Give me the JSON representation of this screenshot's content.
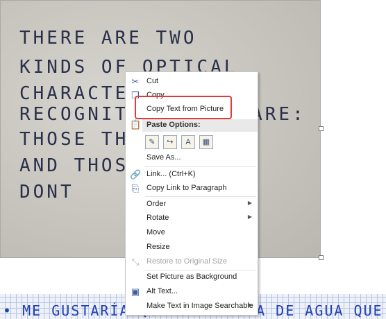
{
  "picture": {
    "lines": [
      "THERE ARE TWO",
      "KINDS OF OPTICAL",
      "CHARACTER",
      "RECOGNITION SOFTWARE:",
      "THOSE THAT",
      "AND THOSE",
      "DONT"
    ]
  },
  "bottom_strip": {
    "text": "• ME GUSTARÍA QUE CADA GOTA DE AGUA QUE"
  },
  "menu": {
    "cut": {
      "label": "Cut",
      "icon": "scissors-icon"
    },
    "copy": {
      "label": "Copy",
      "icon": "copy-icon"
    },
    "copy_text": {
      "label": "Copy Text from Picture"
    },
    "paste_header": {
      "label": "Paste Options:",
      "icon": "clipboard-icon"
    },
    "paste_options": [
      "paste-keep-formatting-icon",
      "paste-merge-formatting-icon",
      "paste-text-only-icon",
      "paste-picture-icon"
    ],
    "save_as": {
      "label": "Save As..."
    },
    "link": {
      "label": "Link...  (Ctrl+K)",
      "icon": "link-icon"
    },
    "copy_link": {
      "label": "Copy Link to Paragraph",
      "icon": "copy-link-icon"
    },
    "order": {
      "label": "Order"
    },
    "rotate": {
      "label": "Rotate"
    },
    "move": {
      "label": "Move"
    },
    "resize": {
      "label": "Resize"
    },
    "restore": {
      "label": "Restore to Original Size",
      "icon": "restore-icon"
    },
    "set_bg": {
      "label": "Set Picture as Background"
    },
    "alt_text": {
      "label": "Alt Text...",
      "icon": "alt-text-icon"
    },
    "searchable": {
      "label": "Make Text in Image Searchable"
    }
  },
  "colors": {
    "highlight": "#e23a3a",
    "menu_bg": "#ffffff",
    "icon": "#3a5d9c"
  }
}
